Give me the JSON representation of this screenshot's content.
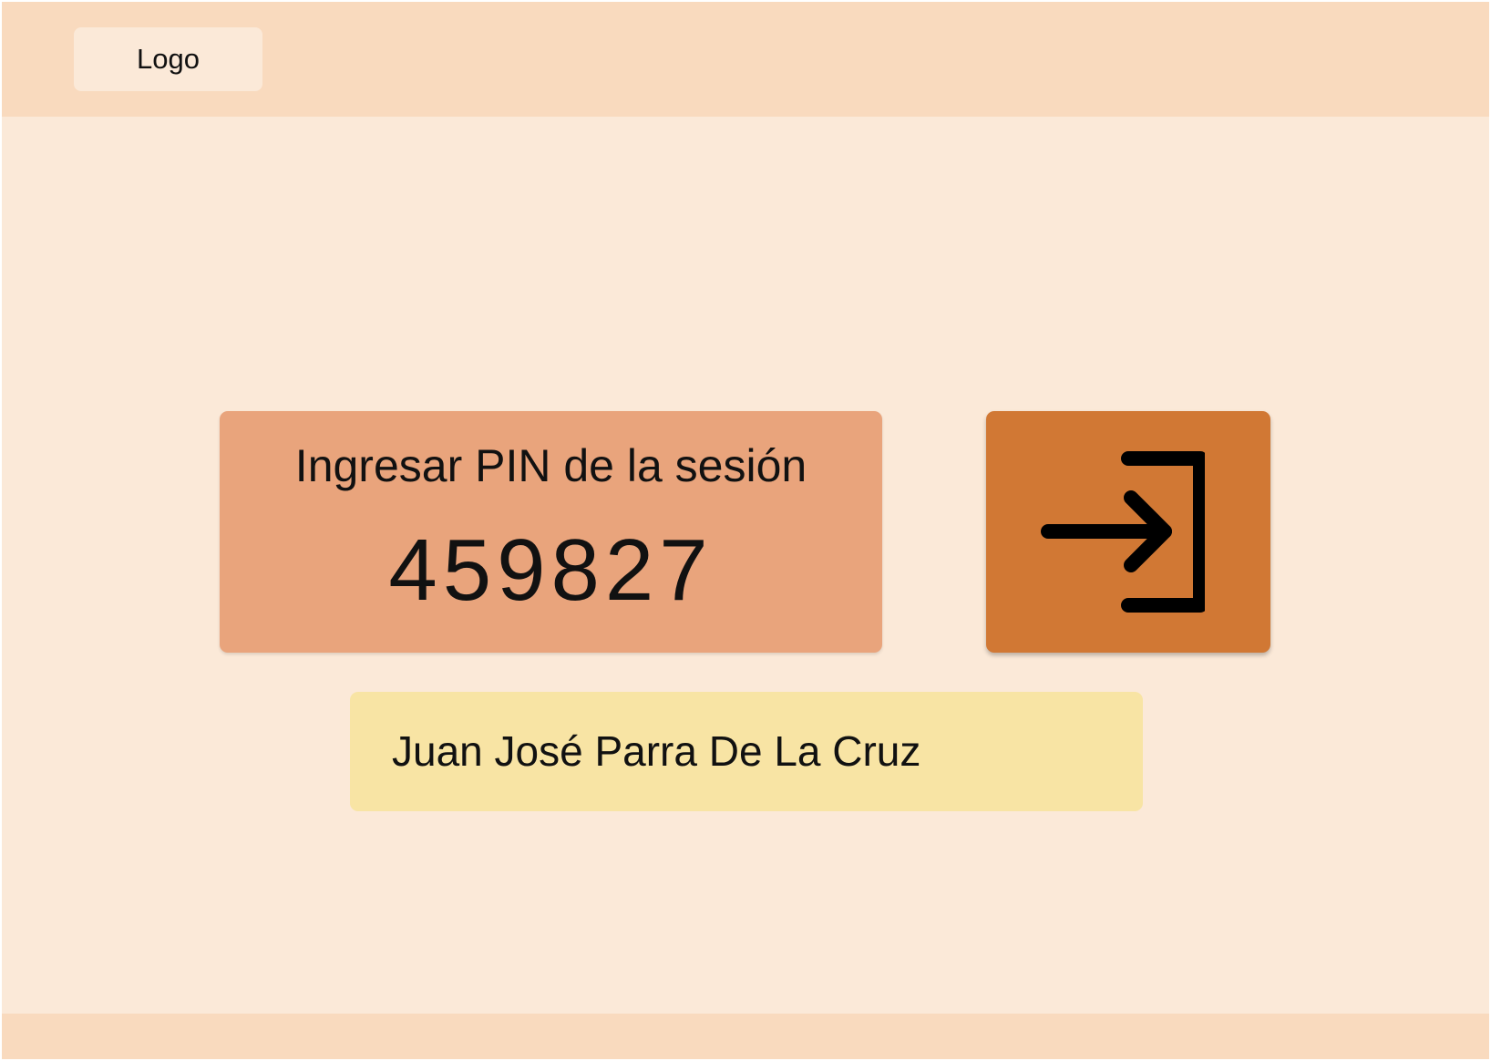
{
  "header": {
    "logo_label": "Logo"
  },
  "pin_card": {
    "label": "Ingresar PIN de la sesión",
    "pin": "459827"
  },
  "enter_button": {
    "icon": "login-icon"
  },
  "user": {
    "name": "Juan José Parra De La Cruz"
  },
  "colors": {
    "page_background": "#fbe9d8",
    "header_background": "#f9dabe",
    "pin_card_background": "#e9a47c",
    "enter_button_background": "#d17834",
    "name_field_background": "#f8e4a4"
  }
}
